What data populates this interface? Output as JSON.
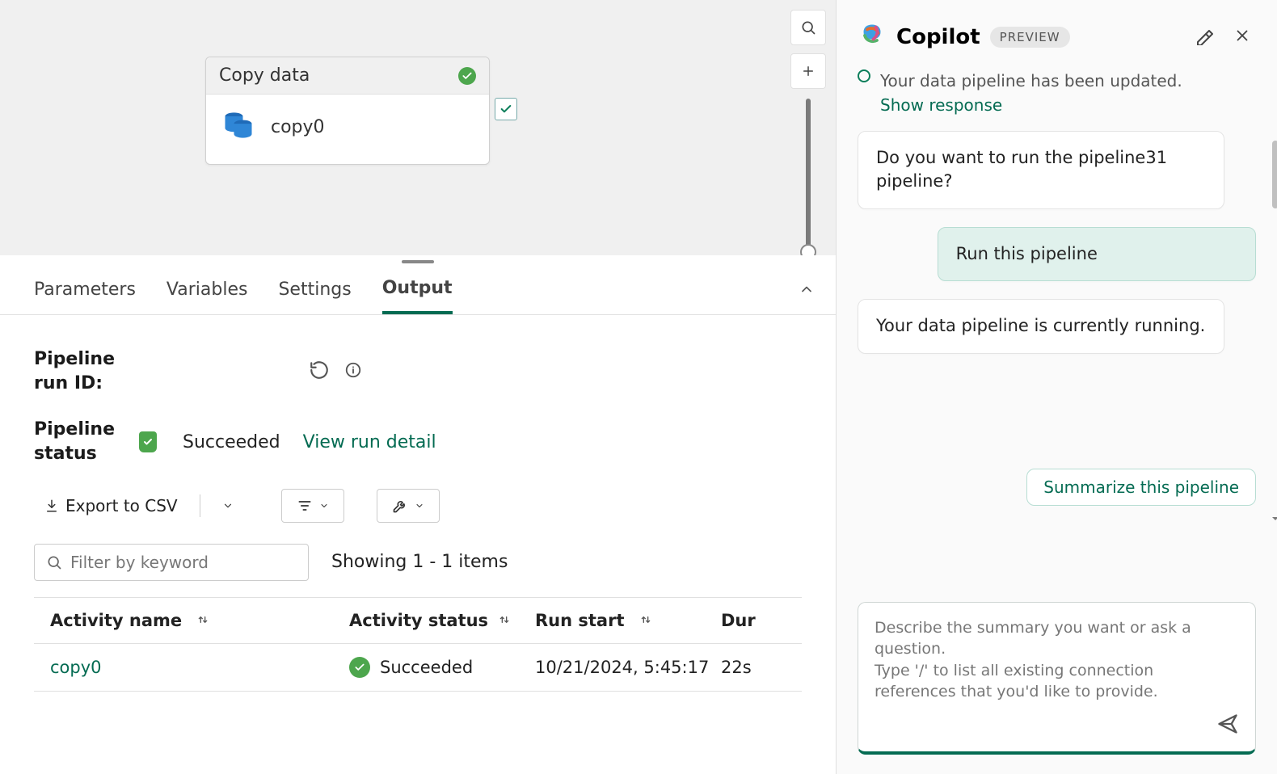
{
  "canvas": {
    "activity_title": "Copy data",
    "activity_name": "copy0"
  },
  "tabs": {
    "parameters": "Parameters",
    "variables": "Variables",
    "settings": "Settings",
    "output": "Output"
  },
  "output": {
    "run_id_label": "Pipeline run ID:",
    "status_label": "Pipeline status",
    "status_value": "Succeeded",
    "view_run_detail": "View run detail",
    "export_csv": "Export to CSV",
    "filter_placeholder": "Filter by keyword",
    "showing": "Showing 1 - 1 items",
    "columns": {
      "activity_name": "Activity name",
      "activity_status": "Activity status",
      "run_start": "Run start",
      "duration": "Dur"
    },
    "rows": [
      {
        "name": "copy0",
        "status": "Succeeded",
        "start": "10/21/2024, 5:45:17",
        "duration": "22s"
      }
    ]
  },
  "copilot": {
    "title": "Copilot",
    "badge": "PREVIEW",
    "truncated": "Your data pipeline has been updated.",
    "show_response": "Show response",
    "messages": {
      "m1": "Do you want to run the pipeline31 pipeline?",
      "m2": "Run this pipeline",
      "m3": "Your data pipeline is currently running."
    },
    "suggestion": "Summarize this pipeline",
    "input_placeholder": "Describe the summary you want or ask a question.\nType '/' to list all existing connection references that you'd like to provide."
  }
}
